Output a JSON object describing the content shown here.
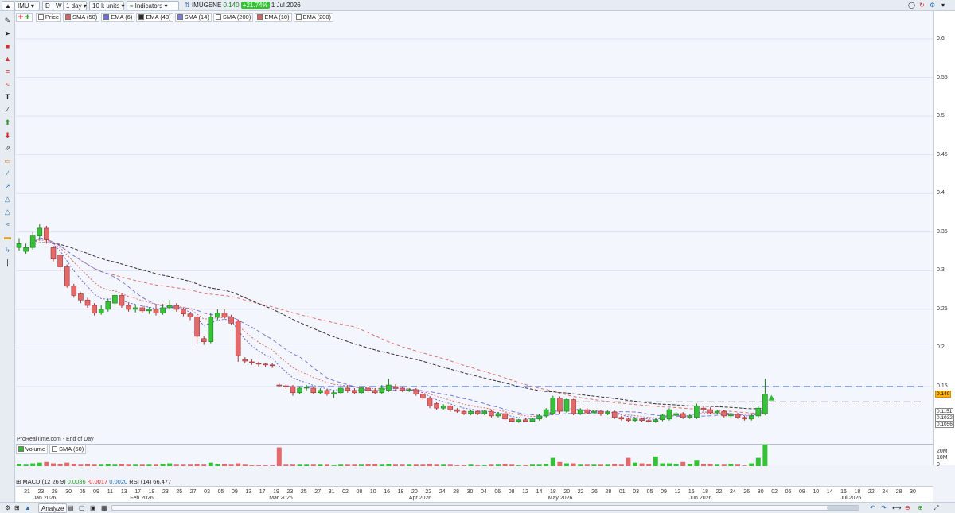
{
  "toolbar": {
    "symbol": "IMU",
    "btn_d": "D",
    "btn_w": "W",
    "interval": "1 day",
    "units": "10 k units",
    "indicators": "Indicators",
    "instrument": "IMUGENE",
    "price": "0.140",
    "change": "+21.74%",
    "date": "1 Jul 2026"
  },
  "legend": [
    {
      "label": "Price",
      "color": "#ffffff"
    },
    {
      "label": "SMA (50)",
      "color": "#e06060"
    },
    {
      "label": "EMA (6)",
      "color": "#6a6ae8"
    },
    {
      "label": "EMA (43)",
      "color": "#2c2c2c"
    },
    {
      "label": "SMA (14)",
      "color": "#7b7be0"
    },
    {
      "label": "SMA (200)",
      "color": "#ffffff"
    },
    {
      "label": "EMA (10)",
      "color": "#e06060"
    },
    {
      "label": "EMA (200)",
      "color": "#ffffff"
    }
  ],
  "footnote": "ProRealTime.com - End of Day",
  "price_axis": {
    "ticks": [
      "0.6",
      "0.55",
      "0.5",
      "0.45",
      "0.4",
      "0.35",
      "0.3",
      "0.25",
      "0.2",
      "0.15"
    ],
    "current": "0.140",
    "boxes": [
      "0.1151",
      "0.1032",
      "0.1056"
    ]
  },
  "volume": {
    "legend_volume": "Volume",
    "legend_sma": "SMA (50)",
    "ticks": [
      "20M",
      "10M",
      "0"
    ]
  },
  "macd": {
    "label": "MACD (12 26 9)",
    "v1": "0.0036",
    "v2": "-0.0017",
    "v3": "0.0020",
    "rsi": "RSI (14) 66.477"
  },
  "bottom": {
    "analyze": "Analyze"
  },
  "x_days": [
    "21",
    "23",
    "28",
    "30",
    "05",
    "09",
    "11",
    "13",
    "17",
    "19",
    "23",
    "25",
    "27",
    "03",
    "05",
    "09",
    "13",
    "17",
    "19",
    "23",
    "25",
    "27",
    "31",
    "02",
    "08",
    "10",
    "16",
    "18",
    "20",
    "22",
    "24",
    "28",
    "30",
    "04",
    "06",
    "08",
    "12",
    "14",
    "18",
    "20",
    "22",
    "26",
    "28",
    "01",
    "03",
    "05",
    "09",
    "12",
    "16",
    "18",
    "22",
    "24",
    "26",
    "30",
    "02",
    "06",
    "08",
    "10",
    "14",
    "16",
    "18",
    "22",
    "24",
    "28",
    "30"
  ],
  "x_months": [
    "Jan 2026",
    "Feb 2026",
    "Mar 2026",
    "Apr 2026",
    "May 2026",
    "Jun 2026",
    "Jul 2026"
  ],
  "chart_data": {
    "type": "candlestick",
    "instrument": "IMUGENE",
    "ylim": [
      0.09,
      0.63
    ],
    "price_ticks": [
      0.6,
      0.55,
      0.5,
      0.45,
      0.4,
      0.35,
      0.3,
      0.25,
      0.2,
      0.15
    ],
    "reference_lines": [
      0.15,
      0.13
    ],
    "candles": [
      {
        "o": 0.33,
        "c": 0.335,
        "h": 0.342,
        "l": 0.326
      },
      {
        "o": 0.325,
        "c": 0.33,
        "h": 0.335,
        "l": 0.322
      },
      {
        "o": 0.33,
        "c": 0.345,
        "h": 0.35,
        "l": 0.327
      },
      {
        "o": 0.345,
        "c": 0.355,
        "h": 0.36,
        "l": 0.34
      },
      {
        "o": 0.355,
        "c": 0.34,
        "h": 0.358,
        "l": 0.335
      },
      {
        "o": 0.33,
        "c": 0.315,
        "h": 0.332,
        "l": 0.312
      },
      {
        "o": 0.32,
        "c": 0.305,
        "h": 0.322,
        "l": 0.3
      },
      {
        "o": 0.305,
        "c": 0.28,
        "h": 0.308,
        "l": 0.278
      },
      {
        "o": 0.28,
        "c": 0.268,
        "h": 0.283,
        "l": 0.265
      },
      {
        "o": 0.27,
        "c": 0.262,
        "h": 0.272,
        "l": 0.258
      },
      {
        "o": 0.262,
        "c": 0.255,
        "h": 0.265,
        "l": 0.252
      },
      {
        "o": 0.255,
        "c": 0.245,
        "h": 0.258,
        "l": 0.242
      },
      {
        "o": 0.245,
        "c": 0.25,
        "h": 0.255,
        "l": 0.243
      },
      {
        "o": 0.25,
        "c": 0.26,
        "h": 0.264,
        "l": 0.247
      },
      {
        "o": 0.258,
        "c": 0.268,
        "h": 0.27,
        "l": 0.255
      },
      {
        "o": 0.268,
        "c": 0.255,
        "h": 0.27,
        "l": 0.252
      },
      {
        "o": 0.255,
        "c": 0.25,
        "h": 0.258,
        "l": 0.247
      },
      {
        "o": 0.25,
        "c": 0.252,
        "h": 0.256,
        "l": 0.246
      },
      {
        "o": 0.252,
        "c": 0.248,
        "h": 0.255,
        "l": 0.245
      },
      {
        "o": 0.248,
        "c": 0.25,
        "h": 0.253,
        "l": 0.244
      },
      {
        "o": 0.25,
        "c": 0.245,
        "h": 0.255,
        "l": 0.242
      },
      {
        "o": 0.245,
        "c": 0.252,
        "h": 0.257,
        "l": 0.243
      },
      {
        "o": 0.252,
        "c": 0.255,
        "h": 0.262,
        "l": 0.25
      },
      {
        "o": 0.255,
        "c": 0.25,
        "h": 0.258,
        "l": 0.247
      },
      {
        "o": 0.25,
        "c": 0.244,
        "h": 0.252,
        "l": 0.241
      },
      {
        "o": 0.244,
        "c": 0.24,
        "h": 0.246,
        "l": 0.236
      },
      {
        "o": 0.24,
        "c": 0.215,
        "h": 0.242,
        "l": 0.205
      },
      {
        "o": 0.212,
        "c": 0.208,
        "h": 0.215,
        "l": 0.204
      },
      {
        "o": 0.208,
        "c": 0.24,
        "h": 0.245,
        "l": 0.206
      },
      {
        "o": 0.24,
        "c": 0.245,
        "h": 0.25,
        "l": 0.236
      },
      {
        "o": 0.245,
        "c": 0.24,
        "h": 0.25,
        "l": 0.237
      },
      {
        "o": 0.24,
        "c": 0.232,
        "h": 0.243,
        "l": 0.23
      },
      {
        "o": 0.235,
        "c": 0.19,
        "h": 0.237,
        "l": 0.182
      },
      {
        "o": 0.185,
        "c": 0.183,
        "h": 0.188,
        "l": 0.18
      },
      {
        "o": 0.182,
        "c": 0.181,
        "h": 0.185,
        "l": 0.178
      },
      {
        "o": 0.18,
        "c": 0.179,
        "h": 0.182,
        "l": 0.176
      },
      {
        "o": 0.179,
        "c": 0.178,
        "h": 0.181,
        "l": 0.175
      },
      {
        "o": 0.178,
        "c": 0.177,
        "h": 0.18,
        "l": 0.174
      },
      {
        "o": 0.152,
        "c": 0.151,
        "h": 0.155,
        "l": 0.15
      },
      {
        "o": 0.151,
        "c": 0.15,
        "h": 0.153,
        "l": 0.147
      },
      {
        "o": 0.15,
        "c": 0.142,
        "h": 0.152,
        "l": 0.138
      },
      {
        "o": 0.142,
        "c": 0.148,
        "h": 0.15,
        "l": 0.14
      },
      {
        "o": 0.148,
        "c": 0.149,
        "h": 0.152,
        "l": 0.145
      },
      {
        "o": 0.148,
        "c": 0.142,
        "h": 0.15,
        "l": 0.14
      },
      {
        "o": 0.142,
        "c": 0.145,
        "h": 0.148,
        "l": 0.14
      },
      {
        "o": 0.145,
        "c": 0.14,
        "h": 0.147,
        "l": 0.138
      },
      {
        "o": 0.14,
        "c": 0.142,
        "h": 0.145,
        "l": 0.135
      },
      {
        "o": 0.142,
        "c": 0.148,
        "h": 0.15,
        "l": 0.14
      },
      {
        "o": 0.148,
        "c": 0.145,
        "h": 0.152,
        "l": 0.142
      },
      {
        "o": 0.145,
        "c": 0.142,
        "h": 0.148,
        "l": 0.14
      },
      {
        "o": 0.142,
        "c": 0.148,
        "h": 0.15,
        "l": 0.14
      },
      {
        "o": 0.148,
        "c": 0.145,
        "h": 0.15,
        "l": 0.142
      },
      {
        "o": 0.145,
        "c": 0.142,
        "h": 0.148,
        "l": 0.14
      },
      {
        "o": 0.142,
        "c": 0.148,
        "h": 0.152,
        "l": 0.14
      },
      {
        "o": 0.145,
        "c": 0.152,
        "h": 0.16,
        "l": 0.143
      },
      {
        "o": 0.15,
        "c": 0.148,
        "h": 0.153,
        "l": 0.145
      },
      {
        "o": 0.148,
        "c": 0.145,
        "h": 0.15,
        "l": 0.143
      },
      {
        "o": 0.145,
        "c": 0.146,
        "h": 0.148,
        "l": 0.143
      },
      {
        "o": 0.146,
        "c": 0.14,
        "h": 0.148,
        "l": 0.138
      },
      {
        "o": 0.14,
        "c": 0.135,
        "h": 0.142,
        "l": 0.132
      },
      {
        "o": 0.135,
        "c": 0.125,
        "h": 0.137,
        "l": 0.122
      },
      {
        "o": 0.128,
        "c": 0.122,
        "h": 0.13,
        "l": 0.12
      },
      {
        "o": 0.122,
        "c": 0.125,
        "h": 0.127,
        "l": 0.12
      },
      {
        "o": 0.125,
        "c": 0.12,
        "h": 0.126,
        "l": 0.117
      },
      {
        "o": 0.12,
        "c": 0.118,
        "h": 0.122,
        "l": 0.116
      },
      {
        "o": 0.118,
        "c": 0.115,
        "h": 0.12,
        "l": 0.113
      },
      {
        "o": 0.115,
        "c": 0.118,
        "h": 0.12,
        "l": 0.113
      },
      {
        "o": 0.118,
        "c": 0.115,
        "h": 0.12,
        "l": 0.113
      },
      {
        "o": 0.115,
        "c": 0.118,
        "h": 0.12,
        "l": 0.113
      },
      {
        "o": 0.118,
        "c": 0.112,
        "h": 0.12,
        "l": 0.11
      },
      {
        "o": 0.112,
        "c": 0.115,
        "h": 0.117,
        "l": 0.11
      },
      {
        "o": 0.115,
        "c": 0.108,
        "h": 0.117,
        "l": 0.106
      },
      {
        "o": 0.108,
        "c": 0.105,
        "h": 0.11,
        "l": 0.104
      },
      {
        "o": 0.105,
        "c": 0.107,
        "h": 0.108,
        "l": 0.103
      },
      {
        "o": 0.107,
        "c": 0.105,
        "h": 0.109,
        "l": 0.104
      },
      {
        "o": 0.105,
        "c": 0.108,
        "h": 0.11,
        "l": 0.104
      },
      {
        "o": 0.108,
        "c": 0.112,
        "h": 0.114,
        "l": 0.106
      },
      {
        "o": 0.112,
        "c": 0.12,
        "h": 0.122,
        "l": 0.11
      },
      {
        "o": 0.115,
        "c": 0.135,
        "h": 0.138,
        "l": 0.113
      },
      {
        "o": 0.135,
        "c": 0.118,
        "h": 0.137,
        "l": 0.115
      },
      {
        "o": 0.118,
        "c": 0.133,
        "h": 0.135,
        "l": 0.116
      },
      {
        "o": 0.133,
        "c": 0.115,
        "h": 0.134,
        "l": 0.113
      },
      {
        "o": 0.115,
        "c": 0.12,
        "h": 0.122,
        "l": 0.113
      },
      {
        "o": 0.12,
        "c": 0.116,
        "h": 0.122,
        "l": 0.114
      },
      {
        "o": 0.116,
        "c": 0.118,
        "h": 0.12,
        "l": 0.114
      },
      {
        "o": 0.118,
        "c": 0.115,
        "h": 0.12,
        "l": 0.112
      },
      {
        "o": 0.115,
        "c": 0.117,
        "h": 0.119,
        "l": 0.113
      },
      {
        "o": 0.117,
        "c": 0.11,
        "h": 0.119,
        "l": 0.108
      },
      {
        "o": 0.11,
        "c": 0.108,
        "h": 0.112,
        "l": 0.106
      },
      {
        "o": 0.108,
        "c": 0.106,
        "h": 0.11,
        "l": 0.104
      },
      {
        "o": 0.106,
        "c": 0.108,
        "h": 0.11,
        "l": 0.104
      },
      {
        "o": 0.108,
        "c": 0.106,
        "h": 0.11,
        "l": 0.104
      },
      {
        "o": 0.106,
        "c": 0.105,
        "h": 0.108,
        "l": 0.103
      },
      {
        "o": 0.105,
        "c": 0.107,
        "h": 0.109,
        "l": 0.103
      },
      {
        "o": 0.107,
        "c": 0.113,
        "h": 0.115,
        "l": 0.105
      },
      {
        "o": 0.108,
        "c": 0.12,
        "h": 0.122,
        "l": 0.106
      },
      {
        "o": 0.113,
        "c": 0.115,
        "h": 0.117,
        "l": 0.11
      },
      {
        "o": 0.115,
        "c": 0.11,
        "h": 0.117,
        "l": 0.108
      },
      {
        "o": 0.11,
        "c": 0.112,
        "h": 0.114,
        "l": 0.108
      },
      {
        "o": 0.11,
        "c": 0.125,
        "h": 0.128,
        "l": 0.108
      },
      {
        "o": 0.122,
        "c": 0.12,
        "h": 0.124,
        "l": 0.118
      },
      {
        "o": 0.12,
        "c": 0.116,
        "h": 0.123,
        "l": 0.114
      },
      {
        "o": 0.116,
        "c": 0.118,
        "h": 0.12,
        "l": 0.114
      },
      {
        "o": 0.118,
        "c": 0.112,
        "h": 0.12,
        "l": 0.11
      },
      {
        "o": 0.112,
        "c": 0.114,
        "h": 0.116,
        "l": 0.11
      },
      {
        "o": 0.114,
        "c": 0.11,
        "h": 0.116,
        "l": 0.108
      },
      {
        "o": 0.11,
        "c": 0.108,
        "h": 0.112,
        "l": 0.106
      },
      {
        "o": 0.108,
        "c": 0.112,
        "h": 0.114,
        "l": 0.106
      },
      {
        "o": 0.112,
        "c": 0.122,
        "h": 0.124,
        "l": 0.11
      },
      {
        "o": 0.115,
        "c": 0.14,
        "h": 0.16,
        "l": 0.113
      }
    ],
    "volume": [
      3,
      2,
      4,
      5,
      6,
      4,
      3,
      5,
      3,
      2,
      3,
      2,
      2,
      3,
      2,
      3,
      2,
      2,
      2,
      2,
      2,
      3,
      4,
      2,
      2,
      2,
      3,
      2,
      5,
      3,
      3,
      2,
      4,
      2,
      1,
      1,
      1,
      1,
      27,
      2,
      2,
      2,
      2,
      2,
      2,
      2,
      1,
      2,
      2,
      2,
      2,
      3,
      3,
      2,
      3,
      2,
      2,
      2,
      2,
      2,
      3,
      2,
      2,
      2,
      1,
      1,
      2,
      1,
      1,
      2,
      2,
      3,
      2,
      1,
      1,
      2,
      2,
      3,
      12,
      6,
      4,
      4,
      2,
      2,
      2,
      2,
      2,
      3,
      2,
      12,
      5,
      4,
      3,
      14,
      4,
      4,
      3,
      6,
      3,
      9,
      3,
      3,
      2,
      2,
      3,
      2,
      1,
      4,
      12,
      42
    ],
    "volume_ylim": [
      0,
      30
    ],
    "volume_unit": "M"
  }
}
